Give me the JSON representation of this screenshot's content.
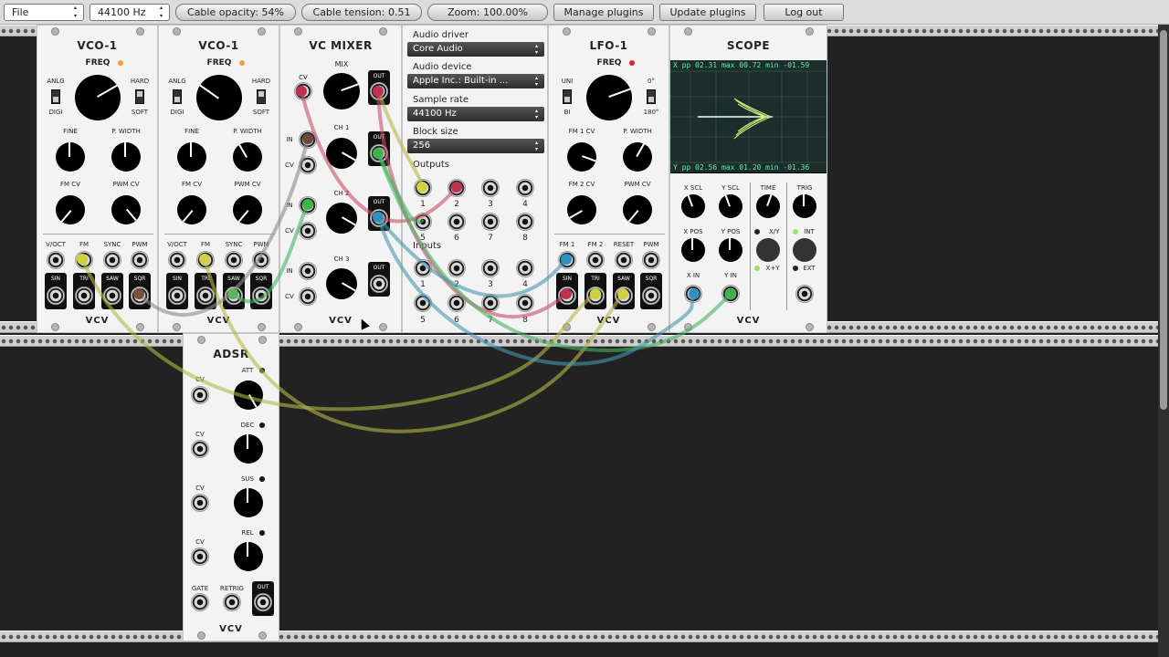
{
  "toolbar": {
    "file_menu": "File",
    "sample_rate": "44100 Hz",
    "cable_opacity": "Cable opacity: 54%",
    "cable_tension": "Cable tension: 0.51",
    "zoom": "Zoom: 100.00%",
    "manage_plugins": "Manage plugins",
    "update_plugins": "Update plugins",
    "log_out": "Log out"
  },
  "vco1a": {
    "title": "VCO-1",
    "freq": "FREQ",
    "anlg": "ANLG",
    "digi": "DIGI",
    "hard": "HARD",
    "soft": "SOFT",
    "fine": "FINE",
    "pwidth": "P. WIDTH",
    "fmcv": "FM CV",
    "pwmcv": "PWM CV",
    "voct": "V/OCT",
    "fm": "FM",
    "sync": "SYNC",
    "pwm": "PWM",
    "sin": "SIN",
    "tri": "TRI",
    "saw": "SAW",
    "sqr": "SQR",
    "logo": "VCV"
  },
  "vco1b": {
    "title": "VCO-1",
    "freq": "FREQ",
    "anlg": "ANLG",
    "digi": "DIGI",
    "hard": "HARD",
    "soft": "SOFT",
    "fine": "FINE",
    "pwidth": "P. WIDTH",
    "fmcv": "FM CV",
    "pwmcv": "PWM CV",
    "voct": "V/OCT",
    "fm": "FM",
    "sync": "SYNC",
    "pwm": "PWM",
    "sin": "SIN",
    "tri": "TRI",
    "saw": "SAW",
    "sqr": "SQR",
    "logo": "VCV"
  },
  "mixer": {
    "title": "VC MIXER",
    "mix": "MIX",
    "cv": "CV",
    "ch1": "CH 1",
    "ch2": "CH 2",
    "ch3": "CH 3",
    "in": "IN",
    "out": "OUT",
    "logo": "VCV"
  },
  "audio": {
    "driver_label": "Audio driver",
    "driver": "Core Audio",
    "device_label": "Audio device",
    "device": "Apple Inc.: Built-in ...",
    "rate_label": "Sample rate",
    "rate": "44100 Hz",
    "block_label": "Block size",
    "block": "256",
    "outputs_label": "Outputs",
    "inputs_label": "Inputs",
    "nums": [
      "1",
      "2",
      "3",
      "4",
      "5",
      "6",
      "7",
      "8"
    ]
  },
  "lfo": {
    "title": "LFO-1",
    "freq": "FREQ",
    "uni": "UNI",
    "bi": "BI",
    "deg0": "0°",
    "deg180": "180°",
    "fm1cv": "FM 1 CV",
    "pwidth": "P. WIDTH",
    "fm2cv": "FM 2 CV",
    "pwmcv": "PWM CV",
    "fm1": "FM 1",
    "fm2": "FM 2",
    "reset": "RESET",
    "pwm": "PWM",
    "sin": "SIN",
    "tri": "TRI",
    "saw": "SAW",
    "sqr": "SQR",
    "logo": "VCV"
  },
  "scope": {
    "title": "SCOPE",
    "xstats": "X   pp  02.31  max  00.72  min -01.59",
    "ystats": "Y   pp  02.56  max  01.20  min -01.36",
    "xscl": "X SCL",
    "yscl": "Y SCL",
    "time": "TIME",
    "trig": "TRIG",
    "xpos": "X POS",
    "ypos": "Y POS",
    "xy": "X/Y",
    "xplusy": "X+Y",
    "int": "INT",
    "ext": "EXT",
    "xin": "X IN",
    "yin": "Y IN",
    "logo": "VCV"
  },
  "adsr": {
    "title": "ADSR",
    "att": "ATT",
    "dec": "DEC",
    "sus": "SUS",
    "rel": "REL",
    "cv": "CV",
    "gate": "GATE",
    "retrig": "RETRIG",
    "out": "OUT",
    "logo": "VCV"
  },
  "colors": {
    "cable_yellow": "#b8b848",
    "cable_red": "#c8506c",
    "cable_green": "#48b060",
    "cable_blue": "#4898b0",
    "cable_gray": "#8a8a8a",
    "led_orange": "#f0a040",
    "led_red": "#e02030"
  }
}
